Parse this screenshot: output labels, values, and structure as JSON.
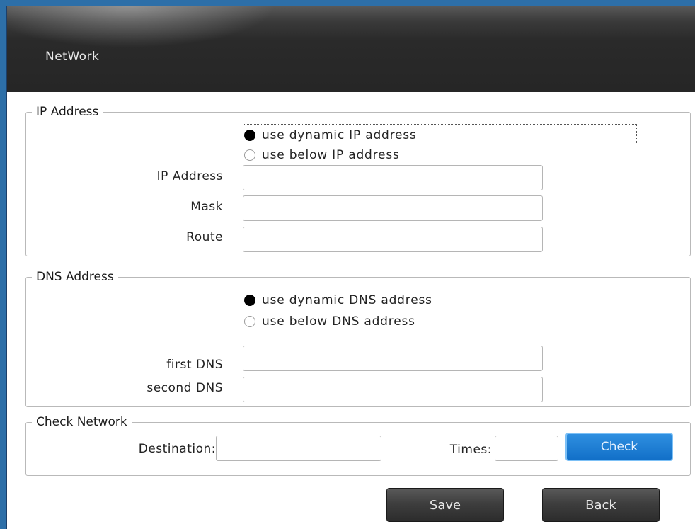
{
  "window": {
    "title": "NetWork"
  },
  "ip_section": {
    "legend": "IP Address",
    "radio_dynamic": "use dynamic IP address",
    "radio_static": "use below IP address",
    "selected": "dynamic",
    "fields": {
      "ip_label": "IP Address",
      "mask_label": "Mask",
      "route_label": "Route",
      "ip_value": "",
      "mask_value": "",
      "route_value": ""
    }
  },
  "dns_section": {
    "legend": "DNS Address",
    "radio_dynamic": "use dynamic DNS address",
    "radio_static": "use below DNS address",
    "selected": "dynamic",
    "fields": {
      "first_label": "first DNS",
      "second_label": "second DNS",
      "first_value": "",
      "second_value": ""
    }
  },
  "check_section": {
    "legend": "Check Network",
    "destination_label": "Destination:",
    "destination_value": "",
    "times_label": "Times:",
    "times_value": "",
    "check_button": "Check"
  },
  "footer": {
    "save_button": "Save",
    "back_button": "Back"
  },
  "colors": {
    "accent": "#1270c8",
    "titlebar": "#262626",
    "button_dark": "#3e3e3e"
  }
}
